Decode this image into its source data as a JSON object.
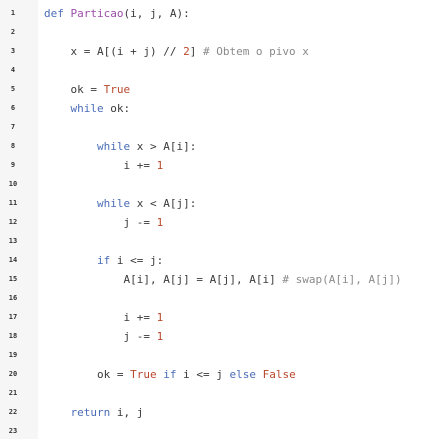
{
  "lines": [
    {
      "n": "1",
      "tokens": [
        [
          "kw",
          "def "
        ],
        [
          "fn",
          "Particao"
        ],
        [
          "",
          "(i, j, A):"
        ]
      ]
    },
    {
      "n": "2",
      "tokens": []
    },
    {
      "n": "3",
      "tokens": [
        [
          "",
          "    x = A[(i + j) // "
        ],
        [
          "num",
          "2"
        ],
        [
          "",
          "] "
        ],
        [
          "cm",
          "# Obtem o pivo x"
        ]
      ]
    },
    {
      "n": "4",
      "tokens": []
    },
    {
      "n": "5",
      "tokens": [
        [
          "",
          "    ok = "
        ],
        [
          "bool",
          "True"
        ]
      ]
    },
    {
      "n": "6",
      "tokens": [
        [
          "kw",
          "    while "
        ],
        [
          "",
          "ok:"
        ]
      ]
    },
    {
      "n": "7",
      "tokens": []
    },
    {
      "n": "8",
      "tokens": [
        [
          "kw",
          "        while "
        ],
        [
          "",
          "x > A[i]:"
        ]
      ]
    },
    {
      "n": "9",
      "tokens": [
        [
          "",
          "            i += "
        ],
        [
          "num",
          "1"
        ]
      ]
    },
    {
      "n": "10",
      "tokens": []
    },
    {
      "n": "11",
      "tokens": [
        [
          "kw",
          "        while "
        ],
        [
          "",
          "x < A[j]:"
        ]
      ]
    },
    {
      "n": "12",
      "tokens": [
        [
          "",
          "            j -= "
        ],
        [
          "num",
          "1"
        ]
      ]
    },
    {
      "n": "13",
      "tokens": []
    },
    {
      "n": "14",
      "tokens": [
        [
          "kw",
          "        if "
        ],
        [
          "",
          "i <= j:"
        ]
      ]
    },
    {
      "n": "15",
      "tokens": [
        [
          "",
          "            A[i], A[j] = A[j], A[i] "
        ],
        [
          "cm",
          "# swap(A[i], A[j])"
        ]
      ]
    },
    {
      "n": "16",
      "tokens": []
    },
    {
      "n": "17",
      "tokens": [
        [
          "",
          "            i += "
        ],
        [
          "num",
          "1"
        ]
      ]
    },
    {
      "n": "18",
      "tokens": [
        [
          "",
          "            j -= "
        ],
        [
          "num",
          "1"
        ]
      ]
    },
    {
      "n": "19",
      "tokens": []
    },
    {
      "n": "20",
      "tokens": [
        [
          "",
          "        ok = "
        ],
        [
          "bool",
          "True"
        ],
        [
          "kw",
          " if "
        ],
        [
          "",
          "i <= j "
        ],
        [
          "kw",
          "else "
        ],
        [
          "bool",
          "False"
        ]
      ]
    },
    {
      "n": "21",
      "tokens": []
    },
    {
      "n": "22",
      "tokens": [
        [
          "kw",
          "    return "
        ],
        [
          "",
          "i, j"
        ]
      ]
    },
    {
      "n": "23",
      "tokens": []
    }
  ]
}
